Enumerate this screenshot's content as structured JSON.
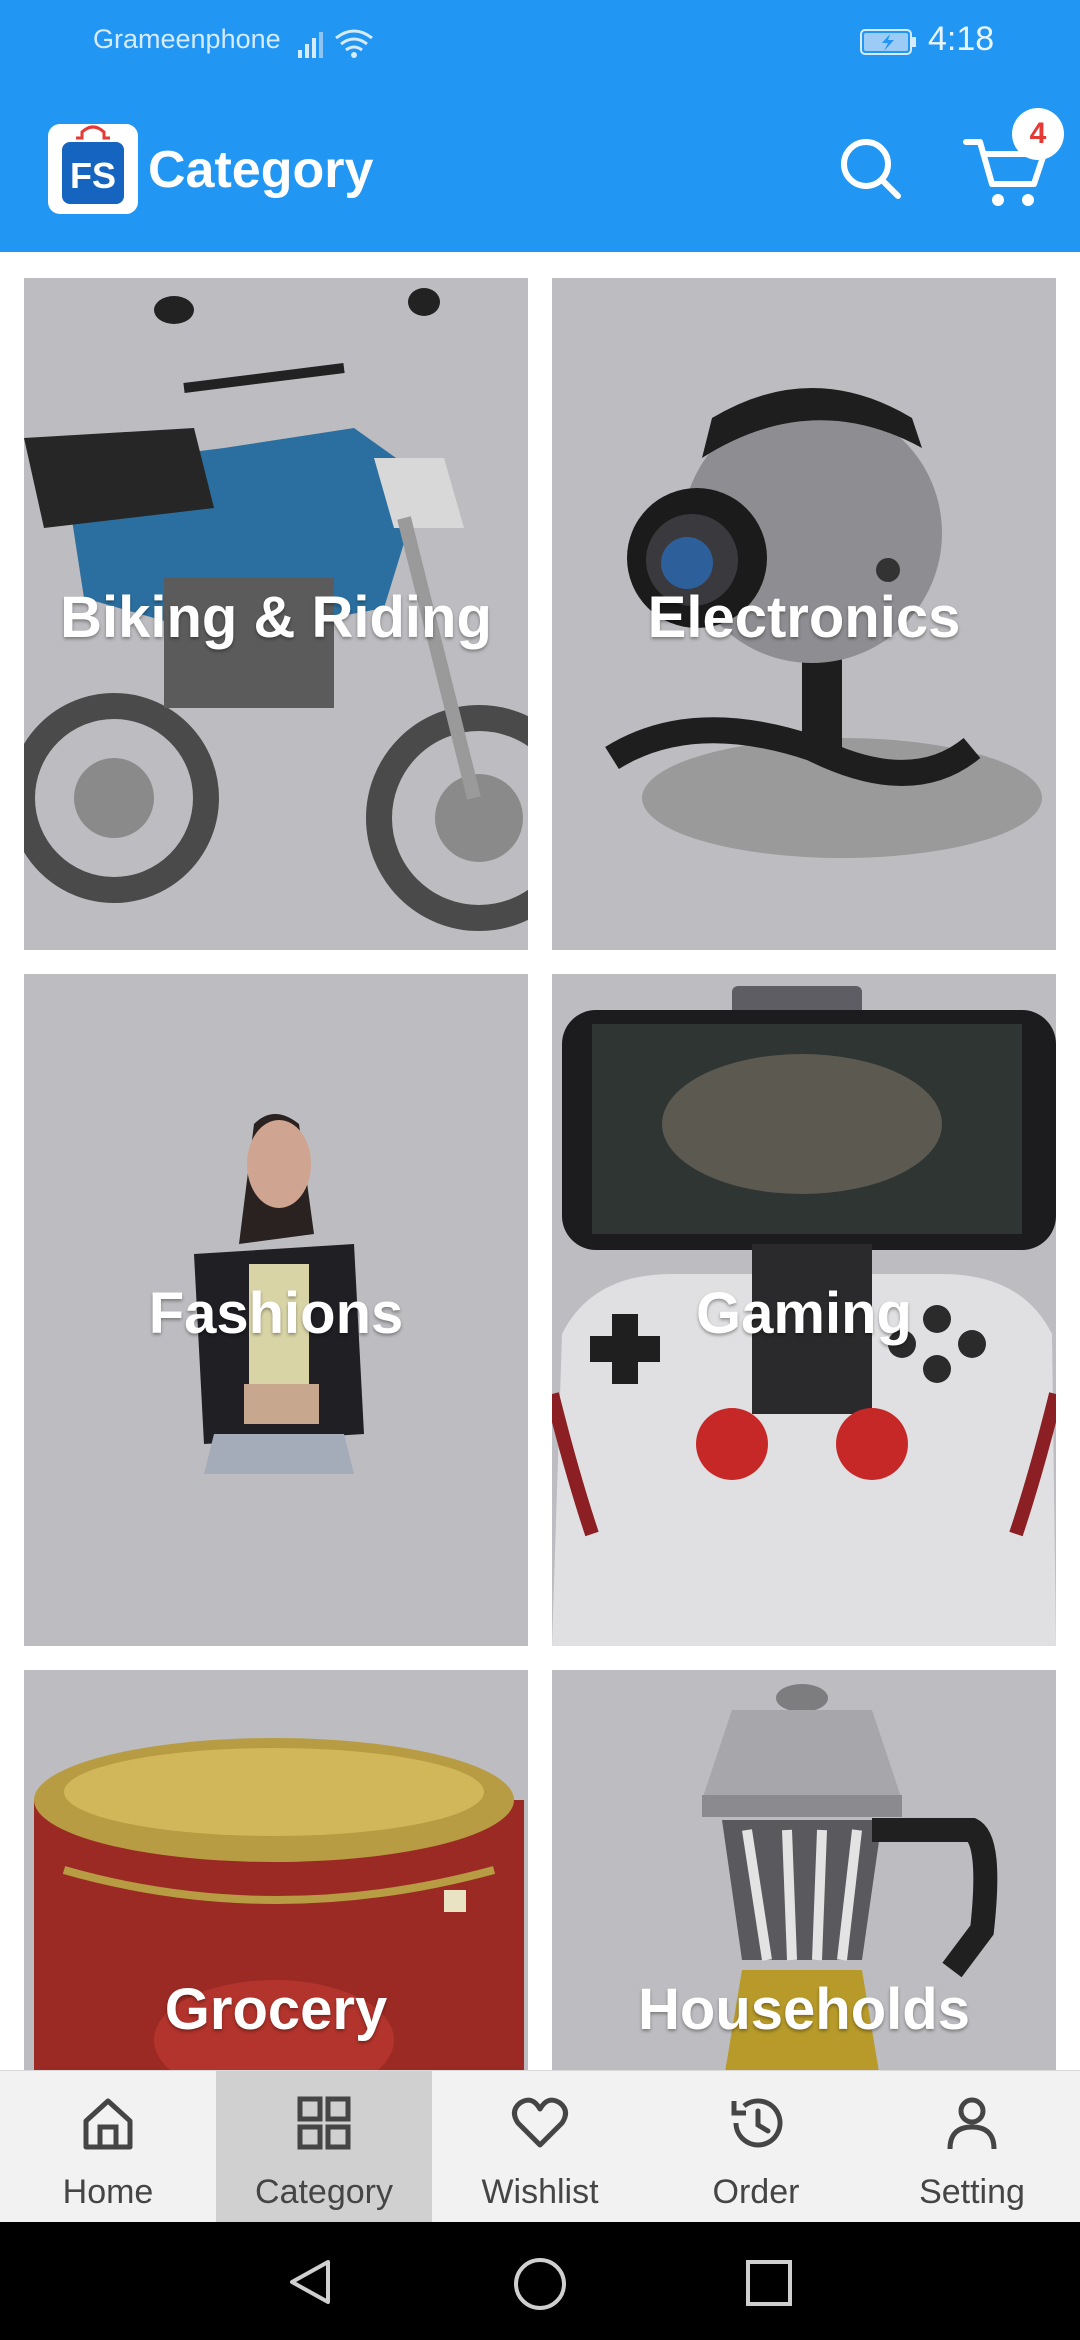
{
  "status_bar": {
    "carrier": "Grameenphone",
    "time": "4:18"
  },
  "header": {
    "logo_text": "FS",
    "title": "Category",
    "cart_count": "4"
  },
  "categories": [
    {
      "label": "Biking & Riding"
    },
    {
      "label": "Electronics"
    },
    {
      "label": "Fashions"
    },
    {
      "label": "Gaming"
    },
    {
      "label": "Grocery"
    },
    {
      "label": "Households"
    }
  ],
  "bottom_nav": {
    "items": [
      {
        "label": "Home",
        "icon": "home-icon"
      },
      {
        "label": "Category",
        "icon": "grid-icon",
        "active": true
      },
      {
        "label": "Wishlist",
        "icon": "heart-icon"
      },
      {
        "label": "Order",
        "icon": "history-icon"
      },
      {
        "label": "Setting",
        "icon": "person-icon"
      }
    ]
  },
  "colors": {
    "primary": "#2196f3",
    "badge_text": "#e53935",
    "tile_bg": "#bdbdc1",
    "nav_bg": "#f2f2f2",
    "nav_active": "#d0d0d0"
  }
}
